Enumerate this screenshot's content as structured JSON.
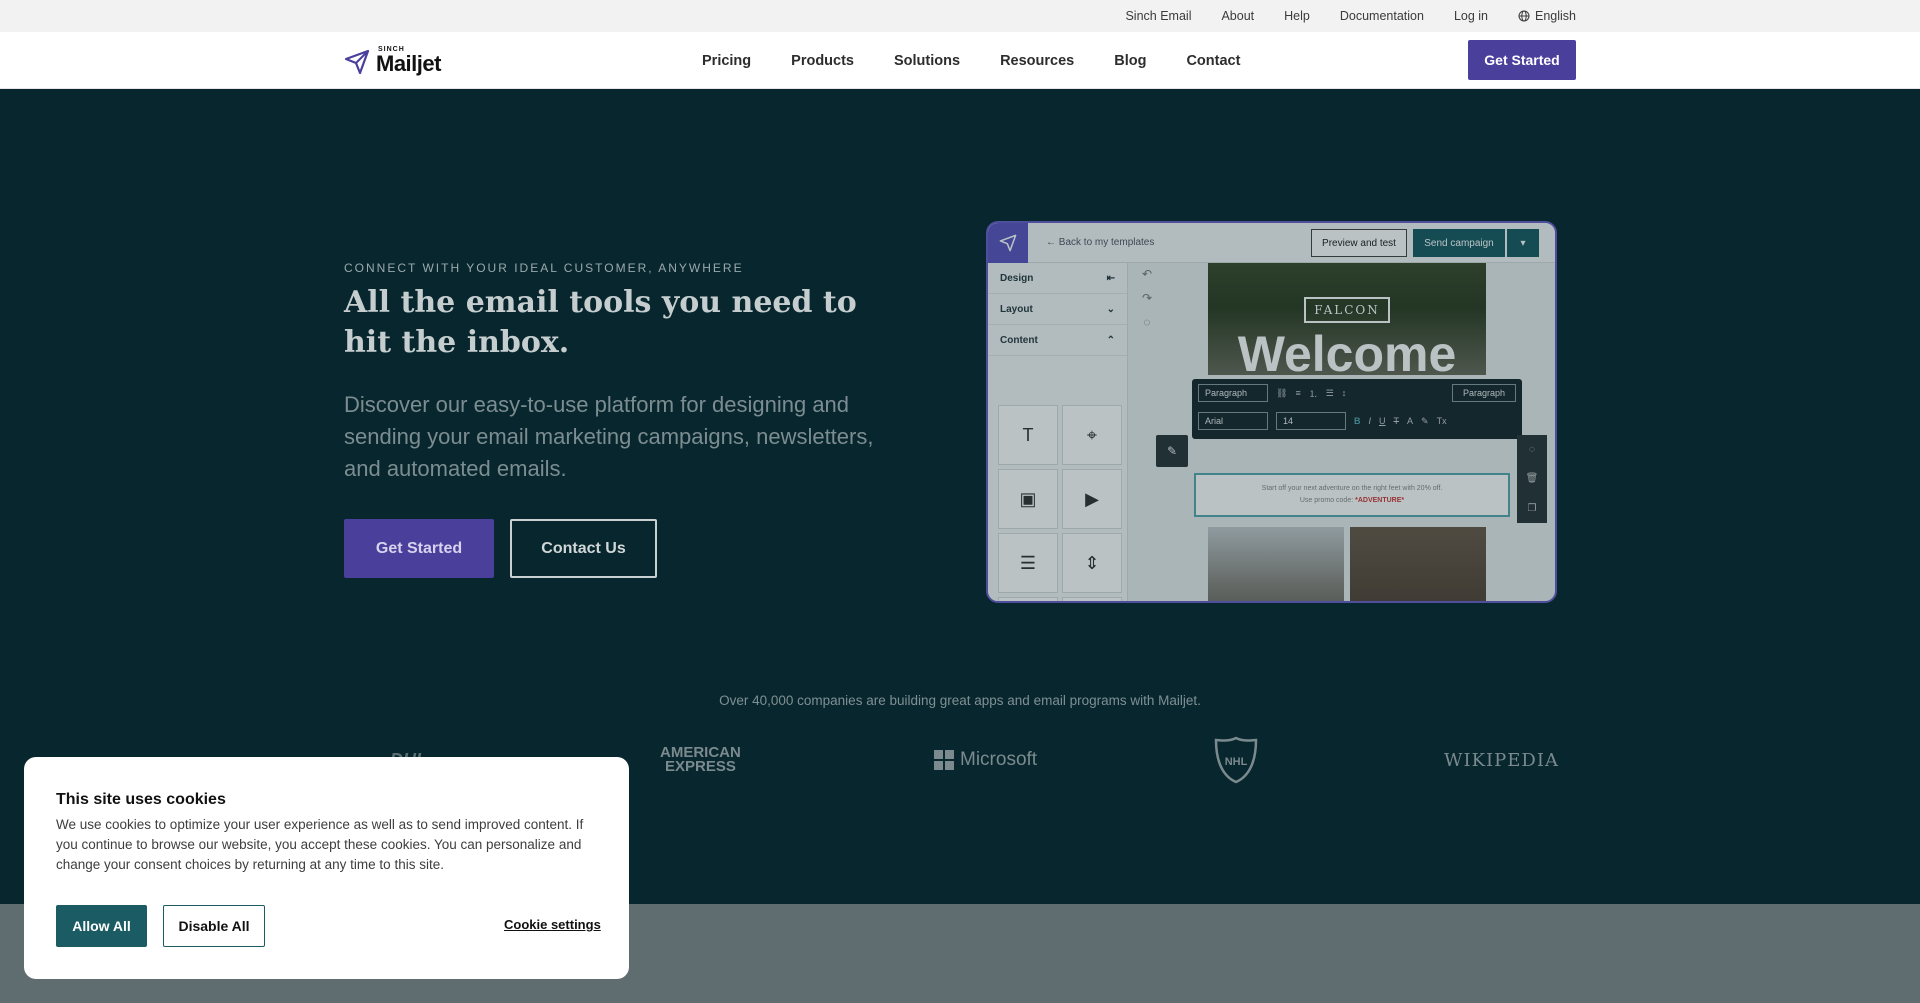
{
  "topbar": {
    "links": [
      "Sinch Email",
      "About",
      "Help",
      "Documentation",
      "Log in"
    ],
    "language": "English"
  },
  "header": {
    "logo_small": "SINCH",
    "logo_brand": "Mailjet",
    "nav": [
      "Pricing",
      "Products",
      "Solutions",
      "Resources",
      "Blog",
      "Contact"
    ],
    "cta": "Get Started"
  },
  "hero": {
    "eyebrow": "CONNECT WITH YOUR IDEAL CUSTOMER, ANYWHERE",
    "title": "All the email tools you need to hit the inbox.",
    "subtitle": "Discover our easy-to-use platform for designing and sending your email marketing campaigns, newsletters, and automated emails.",
    "primary_button": "Get Started",
    "secondary_button": "Contact Us"
  },
  "editor_mock": {
    "back_link": "Back to my templates",
    "preview_button": "Preview and test",
    "send_button": "Send campaign",
    "sidebar": [
      "Design",
      "Layout",
      "Content"
    ],
    "falcon": "FALCON",
    "welcome": "Welcome",
    "toolbar": {
      "block_type": "Paragraph",
      "font": "Arial",
      "size": "14",
      "style_button": "Paragraph"
    },
    "body_text_line1": "Start off your next adventure on the right feet with 20% off.",
    "body_text_line2": "Use promo code: ",
    "promo_code": "*ADVENTURE*"
  },
  "companies": {
    "text": "Over 40,000 companies are building great apps and email programs with Mailjet.",
    "logos": [
      "DHL",
      "AMERICAN",
      "EXPRESS",
      "Microsoft",
      "NHL",
      "WIKIPEDIA"
    ]
  },
  "cookie": {
    "title": "This site uses cookies",
    "text": "We use cookies to optimize your user experience as well as to send improved content. If you continue to browse our website, you accept these cookies. You can personalize and change your consent choices by returning at any time to this site.",
    "allow": "Allow All",
    "disable": "Disable All",
    "settings": "Cookie settings"
  }
}
